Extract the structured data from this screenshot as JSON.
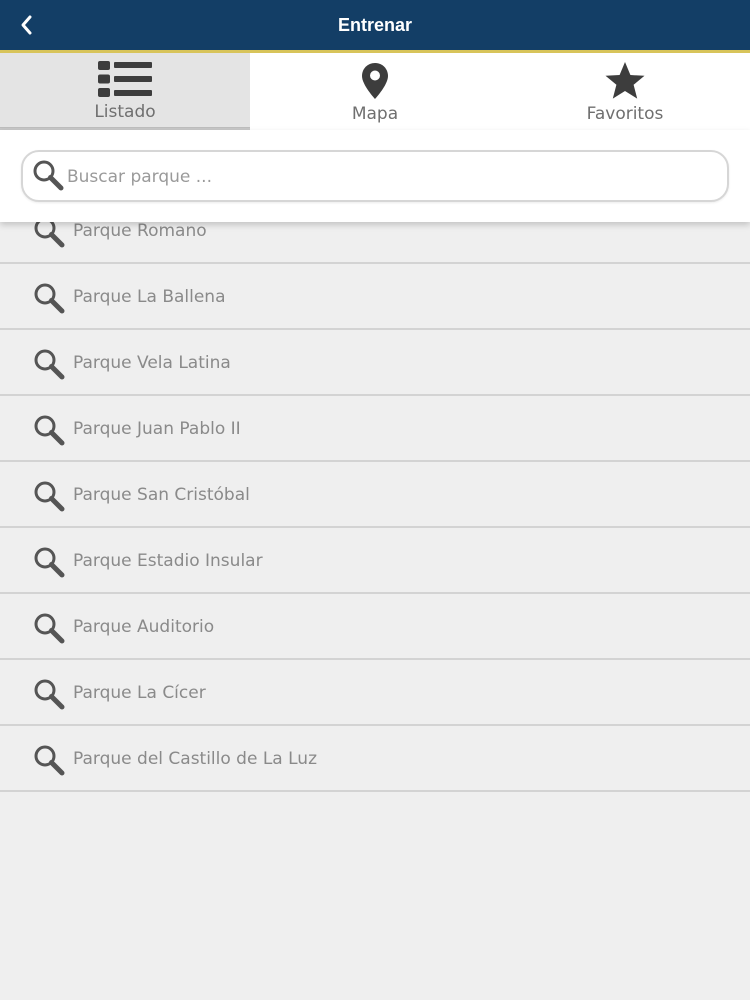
{
  "header": {
    "title": "Entrenar",
    "back_icon": "chevron-left-icon"
  },
  "tabs": [
    {
      "label": "Listado",
      "icon": "list-icon",
      "active": true
    },
    {
      "label": "Mapa",
      "icon": "map-pin-icon",
      "active": false
    },
    {
      "label": "Favoritos",
      "icon": "star-icon",
      "active": false
    }
  ],
  "search": {
    "placeholder": "Buscar parque ...",
    "value": "",
    "icon": "search-icon"
  },
  "parks": [
    {
      "label": "Parque Romano"
    },
    {
      "label": "Parque La Ballena"
    },
    {
      "label": "Parque Vela Latina"
    },
    {
      "label": "Parque Juan Pablo II"
    },
    {
      "label": "Parque San Cristóbal"
    },
    {
      "label": "Parque Estadio Insular"
    },
    {
      "label": "Parque Auditorio"
    },
    {
      "label": "Parque La Cícer"
    },
    {
      "label": "Parque del Castillo de La Luz"
    }
  ],
  "colors": {
    "header_bg": "#133e66",
    "header_accent": "#d8c45a",
    "list_bg": "#efefef",
    "icon": "#555555"
  }
}
